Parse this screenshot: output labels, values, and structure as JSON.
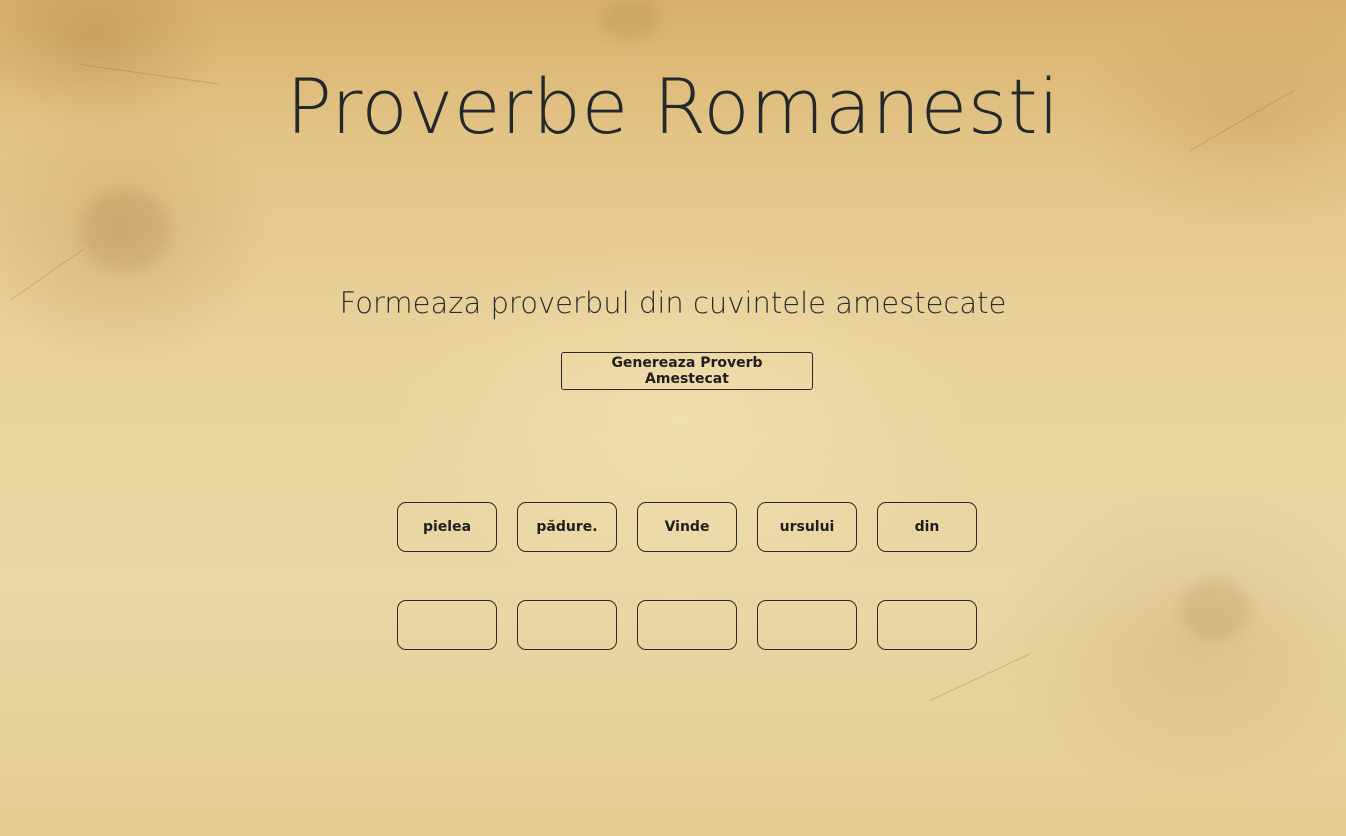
{
  "header": {
    "title": "Proverbe Romanesti"
  },
  "game": {
    "instruction": "Formeaza proverbul din cuvintele amestecate",
    "generate_label": "Genereaza Proverb Amestecat",
    "shuffled_words": [
      "pielea",
      "pădure.",
      "Vinde",
      "ursului",
      "din"
    ],
    "answer_slots": [
      "",
      "",
      "",
      "",
      ""
    ]
  },
  "colors": {
    "text": "#24282b",
    "border": "#2a2a2a",
    "paper": "#e9d29c"
  }
}
